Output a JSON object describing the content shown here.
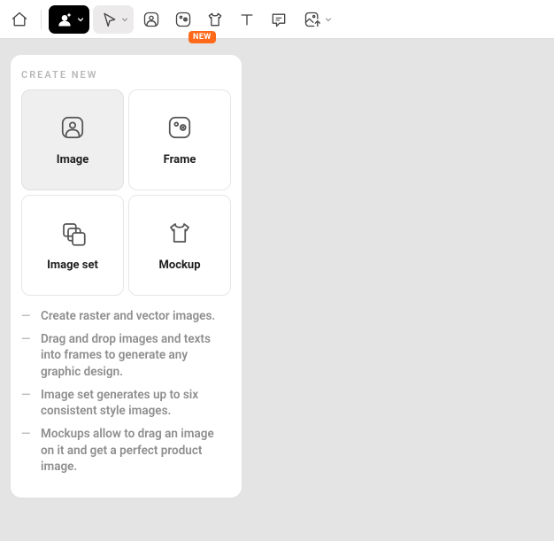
{
  "toolbar": {
    "new_badge": "NEW"
  },
  "panel": {
    "title": "CREATE NEW",
    "cards": {
      "image": "Image",
      "frame": "Frame",
      "image_set": "Image set",
      "mockup": "Mockup"
    },
    "tips": [
      "Create raster and vector images.",
      "Drag and drop images and texts into frames to generate any graphic design.",
      "Image set generates up to six consistent style images.",
      "Mockups allow to drag an image on it and get a perfect product image."
    ]
  }
}
